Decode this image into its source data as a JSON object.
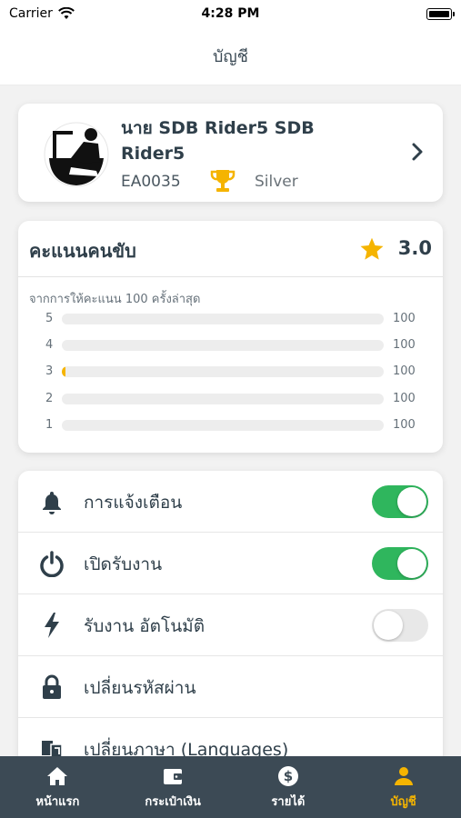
{
  "status_bar": {
    "carrier": "Carrier",
    "time": "4:28 PM"
  },
  "header": {
    "title": "บัญชี"
  },
  "profile": {
    "name": "นาย SDB Rider5 SDB Rider5",
    "code": "EA0035",
    "tier": "Silver"
  },
  "rating": {
    "title": "คะแนนคนขับ",
    "score": "3.0",
    "subtitle": "จากการให้คะแนน 100 ครั้งล่าสุด",
    "rows": [
      {
        "star": "5",
        "count": "100",
        "fill": 0
      },
      {
        "star": "4",
        "count": "100",
        "fill": 0
      },
      {
        "star": "3",
        "count": "100",
        "fill": 0.01
      },
      {
        "star": "2",
        "count": "100",
        "fill": 0
      },
      {
        "star": "1",
        "count": "100",
        "fill": 0
      }
    ]
  },
  "settings": [
    {
      "label": "การแจ้งเตือน",
      "icon": "bell-icon",
      "toggle": true
    },
    {
      "label": "เปิดรับงาน",
      "icon": "power-icon",
      "toggle": true
    },
    {
      "label": "รับงาน อัตโนมัติ",
      "icon": "lightning-icon",
      "toggle": false
    },
    {
      "label": "เปลี่ยนรหัสผ่าน",
      "icon": "lock-icon"
    },
    {
      "label": "เปลี่ยนภาษา (Languages)",
      "icon": "language-icon"
    }
  ],
  "tabs": [
    {
      "label": "หน้าแรก",
      "icon": "home-icon"
    },
    {
      "label": "กระเป๋าเงิน",
      "icon": "wallet-icon"
    },
    {
      "label": "รายได้",
      "icon": "dollar-icon"
    },
    {
      "label": "บัญชี",
      "icon": "person-icon",
      "active": true
    }
  ],
  "colors": {
    "accent": "#f5b400",
    "toggle_on": "#2fb65d",
    "tab_bar": "#3c4a55"
  }
}
